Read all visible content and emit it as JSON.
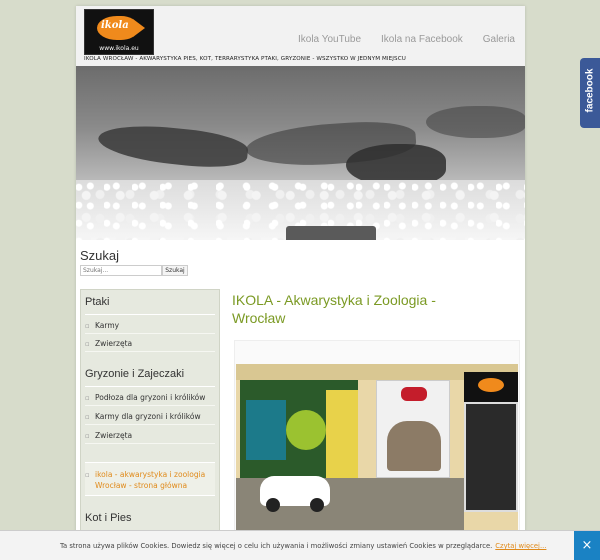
{
  "header": {
    "logo_alt": "ikola",
    "logo_url": "www.ikola.eu",
    "tagline": "IKOLA WROCŁAW - AKWARYSTYKA PIES, KOT, TERRARYSTYKA PTAKI, GRYZONIE - WSZYSTKO W JEDNYM MIEJSCU",
    "nav": [
      "Ikola YouTube",
      "Ikola na Facebook",
      "Galeria"
    ]
  },
  "search": {
    "title": "Szukaj",
    "placeholder": "Szukaj...",
    "button": "Szukaj"
  },
  "sidebar": {
    "sections": [
      {
        "heading": "Ptaki",
        "items": [
          "Karmy",
          "Zwierzęta"
        ]
      },
      {
        "heading": "Gryzonie i Zajeczaki",
        "items": [
          "Podłoza dla gryzoni i królików",
          "Karmy dla gryzoni i królików",
          "Zwierzęta"
        ]
      },
      {
        "heading": "Kot i Pies",
        "items": []
      }
    ],
    "active_link": "ikola - akwarystyka i zoologia Wrocław - strona główna"
  },
  "content": {
    "title": "IKOLA - Akwarystyka i Zoologia - Wrocław"
  },
  "cookie": {
    "text": "Ta strona używa plików Cookies. Dowiedz się więcej o celu ich używania i możliwości zmiany ustawień Cookies w przeglądarce.",
    "link": "Czytaj więcej...",
    "close": "×"
  },
  "facebook_tab": "facebook",
  "colors": {
    "accent_green": "#7b9a24",
    "accent_orange": "#e08a1a",
    "facebook_blue": "#3b5998",
    "cookie_close_blue": "#1a82c4"
  }
}
